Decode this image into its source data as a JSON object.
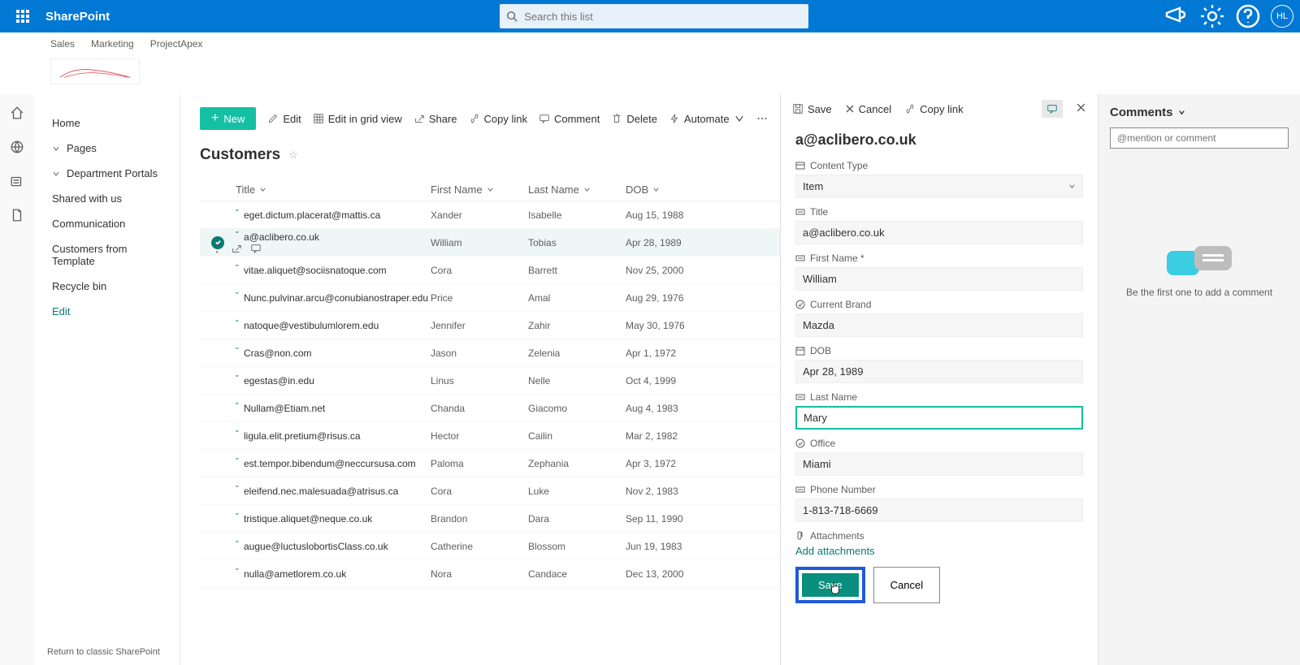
{
  "suite": {
    "title": "SharePoint",
    "search_placeholder": "Search this list",
    "avatar_initials": "HL"
  },
  "hub_links": [
    "Sales",
    "Marketing",
    "ProjectApex"
  ],
  "leftnav": {
    "items": [
      {
        "label": "Home",
        "type": "plain"
      },
      {
        "label": "Pages",
        "type": "chev"
      },
      {
        "label": "Department Portals",
        "type": "chev"
      },
      {
        "label": "Shared with us",
        "type": "plain"
      },
      {
        "label": "Communication",
        "type": "plain"
      },
      {
        "label": "Customers from Template",
        "type": "plain"
      },
      {
        "label": "Recycle bin",
        "type": "plain"
      },
      {
        "label": "Edit",
        "type": "link"
      }
    ],
    "footer": "Return to classic SharePoint"
  },
  "cmdbar": {
    "new": "New",
    "edit": "Edit",
    "grid": "Edit in grid view",
    "share": "Share",
    "copy": "Copy link",
    "comment": "Comment",
    "delete": "Delete",
    "automate": "Automate"
  },
  "list": {
    "title": "Customers",
    "columns": [
      "Title",
      "First Name",
      "Last Name",
      "DOB"
    ],
    "rows": [
      {
        "title": "eget.dictum.placerat@mattis.ca",
        "fn": "Xander",
        "ln": "Isabelle",
        "dob": "Aug 15, 1988"
      },
      {
        "title": "a@aclibero.co.uk",
        "fn": "William",
        "ln": "Tobias",
        "dob": "Apr 28, 1989",
        "selected": true
      },
      {
        "title": "vitae.aliquet@sociisnatoque.com",
        "fn": "Cora",
        "ln": "Barrett",
        "dob": "Nov 25, 2000"
      },
      {
        "title": "Nunc.pulvinar.arcu@conubianostraper.edu",
        "fn": "Price",
        "ln": "Amal",
        "dob": "Aug 29, 1976"
      },
      {
        "title": "natoque@vestibulumlorem.edu",
        "fn": "Jennifer",
        "ln": "Zahir",
        "dob": "May 30, 1976"
      },
      {
        "title": "Cras@non.com",
        "fn": "Jason",
        "ln": "Zelenia",
        "dob": "Apr 1, 1972"
      },
      {
        "title": "egestas@in.edu",
        "fn": "Linus",
        "ln": "Nelle",
        "dob": "Oct 4, 1999"
      },
      {
        "title": "Nullam@Etiam.net",
        "fn": "Chanda",
        "ln": "Giacomo",
        "dob": "Aug 4, 1983"
      },
      {
        "title": "ligula.elit.pretium@risus.ca",
        "fn": "Hector",
        "ln": "Cailin",
        "dob": "Mar 2, 1982"
      },
      {
        "title": "est.tempor.bibendum@neccursusa.com",
        "fn": "Paloma",
        "ln": "Zephania",
        "dob": "Apr 3, 1972"
      },
      {
        "title": "eleifend.nec.malesuada@atrisus.ca",
        "fn": "Cora",
        "ln": "Luke",
        "dob": "Nov 2, 1983"
      },
      {
        "title": "tristique.aliquet@neque.co.uk",
        "fn": "Brandon",
        "ln": "Dara",
        "dob": "Sep 11, 1990"
      },
      {
        "title": "augue@luctuslobortisClass.co.uk",
        "fn": "Catherine",
        "ln": "Blossom",
        "dob": "Jun 19, 1983"
      },
      {
        "title": "nulla@ametlorem.co.uk",
        "fn": "Nora",
        "ln": "Candace",
        "dob": "Dec 13, 2000"
      }
    ]
  },
  "panel": {
    "bar": {
      "save": "Save",
      "cancel": "Cancel",
      "copy": "Copy link"
    },
    "title": "a@aclibero.co.uk",
    "fields": {
      "content_type": {
        "label": "Content Type",
        "value": "Item"
      },
      "title": {
        "label": "Title",
        "value": "a@aclibero.co.uk"
      },
      "first_name": {
        "label": "First Name *",
        "value": "William"
      },
      "current_brand": {
        "label": "Current Brand",
        "value": "Mazda"
      },
      "dob": {
        "label": "DOB",
        "value": "Apr 28, 1989"
      },
      "last_name": {
        "label": "Last Name",
        "value": "Mary"
      },
      "office": {
        "label": "Office",
        "value": "Miami"
      },
      "phone": {
        "label": "Phone Number",
        "value": "1-813-718-6669"
      },
      "attachments": {
        "label": "Attachments",
        "add": "Add attachments"
      }
    },
    "buttons": {
      "save": "Save",
      "cancel": "Cancel"
    }
  },
  "comments": {
    "header": "Comments",
    "placeholder": "@mention or comment",
    "empty": "Be the first one to add a comment"
  }
}
